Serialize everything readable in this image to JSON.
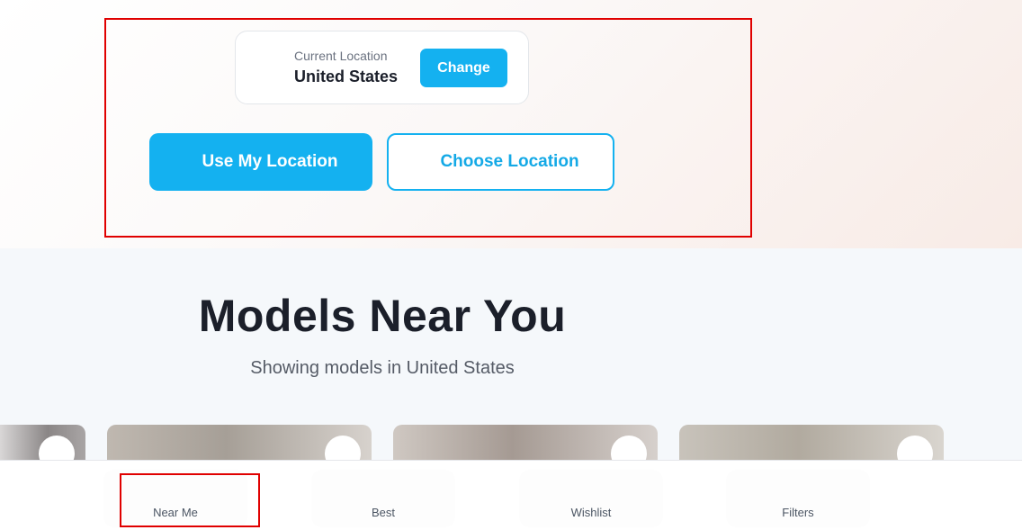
{
  "location": {
    "caption": "Current Location",
    "value": "United States",
    "change_label": "Change",
    "use_my_location_label": "Use My Location",
    "choose_location_label": "Choose Location"
  },
  "section": {
    "title": "Models Near You",
    "subtitle": "Showing models in United States"
  },
  "bottom_nav": {
    "items": [
      {
        "label": "Near Me"
      },
      {
        "label": "Best"
      },
      {
        "label": "Wishlist"
      },
      {
        "label": "Filters"
      }
    ]
  },
  "colors": {
    "accent": "#14b1f0",
    "highlight": "#e00000",
    "text": "#1b1f2a"
  }
}
